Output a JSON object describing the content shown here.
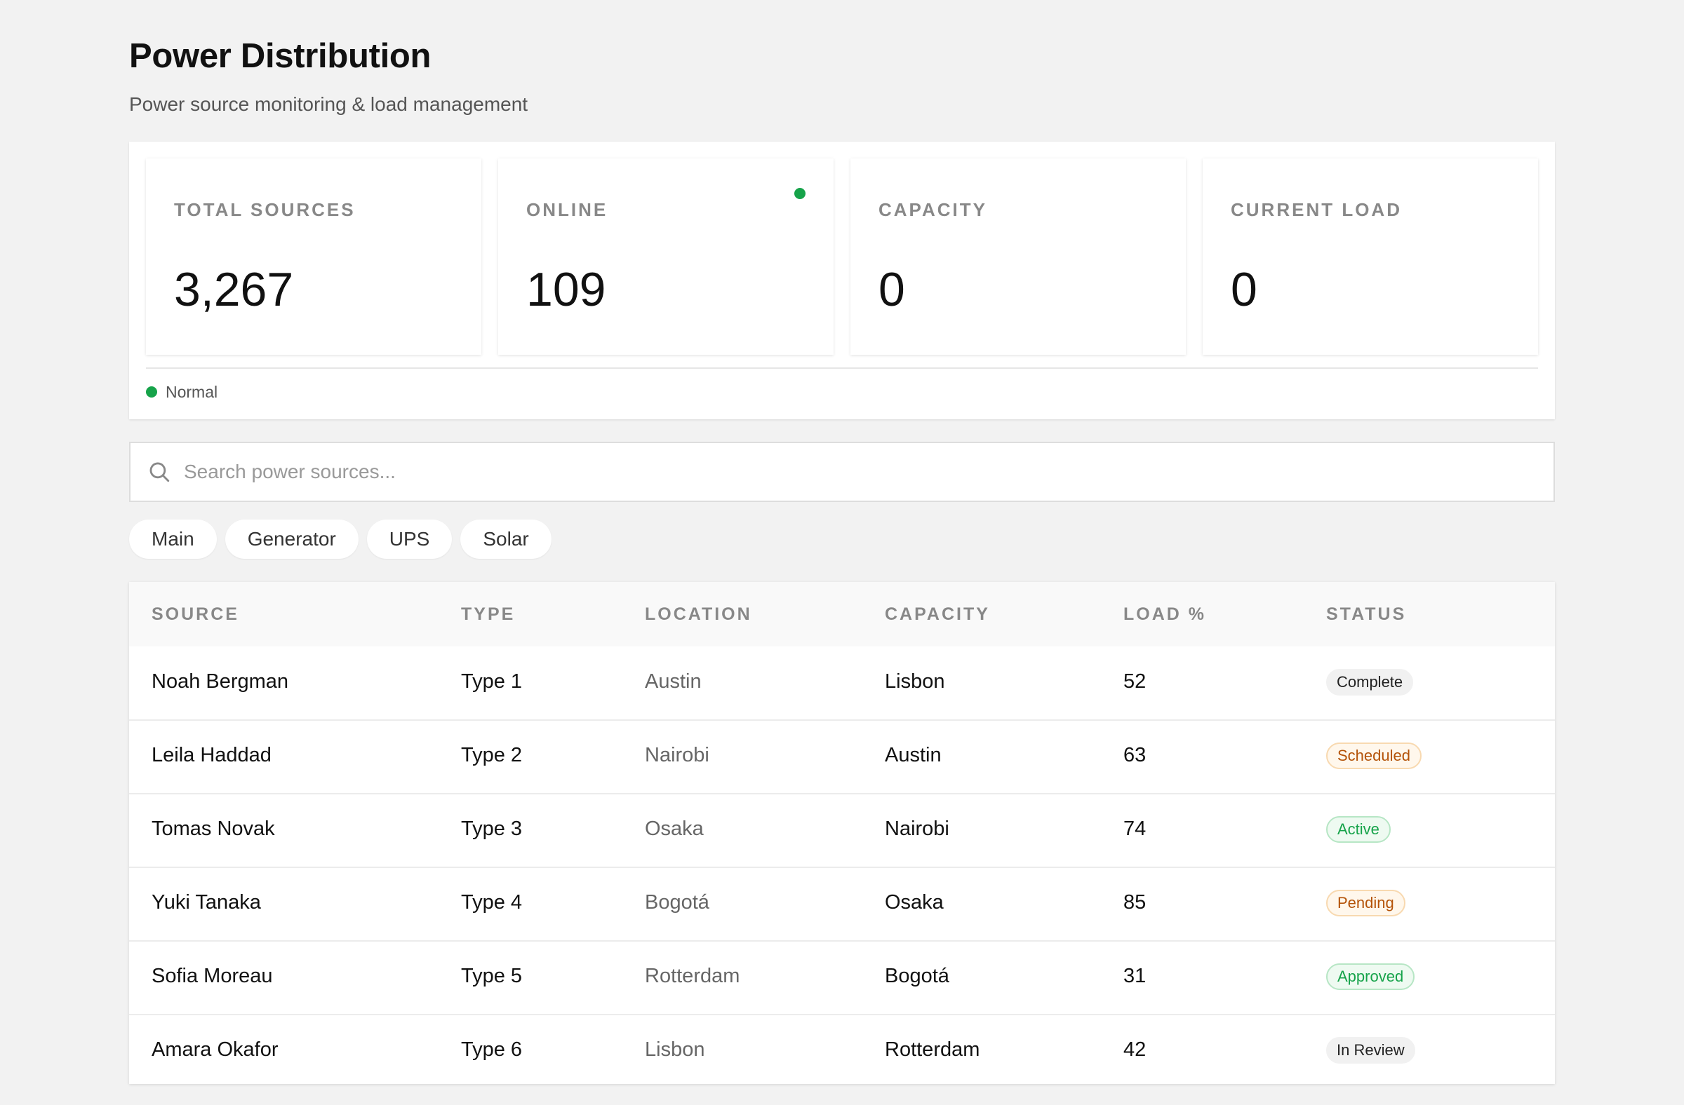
{
  "header": {
    "title": "Power Distribution",
    "subtitle": "Power source monitoring & load management"
  },
  "stats": [
    {
      "label": "TOTAL SOURCES",
      "value": "3,267"
    },
    {
      "label": "ONLINE",
      "value": "109",
      "indicator_color": "#16a34a"
    },
    {
      "label": "CAPACITY",
      "value": "0"
    },
    {
      "label": "CURRENT LOAD",
      "value": "0"
    }
  ],
  "system_status": {
    "text": "Normal",
    "color": "#16a34a"
  },
  "search": {
    "placeholder": "Search power sources...",
    "icon": "search-icon"
  },
  "filters": [
    "Main",
    "Generator",
    "UPS",
    "Solar"
  ],
  "table": {
    "columns": [
      "SOURCE",
      "TYPE",
      "LOCATION",
      "CAPACITY",
      "LOAD %",
      "STATUS"
    ],
    "rows": [
      {
        "source": "Noah Bergman",
        "type": "Type 1",
        "location": "Austin",
        "capacity": "Lisbon",
        "load": "52",
        "status": "Complete",
        "status_style": "neutral"
      },
      {
        "source": "Leila Haddad",
        "type": "Type 2",
        "location": "Nairobi",
        "capacity": "Austin",
        "load": "63",
        "status": "Scheduled",
        "status_style": "amber"
      },
      {
        "source": "Tomas Novak",
        "type": "Type 3",
        "location": "Osaka",
        "capacity": "Nairobi",
        "load": "74",
        "status": "Active",
        "status_style": "green"
      },
      {
        "source": "Yuki Tanaka",
        "type": "Type 4",
        "location": "Bogotá",
        "capacity": "Osaka",
        "load": "85",
        "status": "Pending",
        "status_style": "amber"
      },
      {
        "source": "Sofia Moreau",
        "type": "Type 5",
        "location": "Rotterdam",
        "capacity": "Bogotá",
        "load": "31",
        "status": "Approved",
        "status_style": "green"
      },
      {
        "source": "Amara Okafor",
        "type": "Type 6",
        "location": "Lisbon",
        "capacity": "Rotterdam",
        "load": "42",
        "status": "In Review",
        "status_style": "neutral"
      }
    ]
  }
}
